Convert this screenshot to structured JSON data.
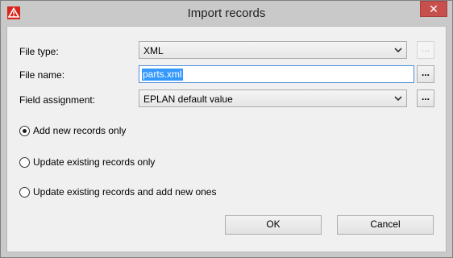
{
  "window": {
    "title": "Import records",
    "app_icon": "eplan-warning-triangle-icon",
    "close_icon": "close-icon",
    "close_glyph": "✕"
  },
  "form": {
    "file_type_label": "File type:",
    "file_type_value": "XML",
    "file_name_label": "File name:",
    "file_name_value": "parts.xml",
    "field_assignment_label": "Field assignment:",
    "field_assignment_value": "EPLAN default value",
    "browse_label": "..."
  },
  "options": {
    "add_new": "Add new records only",
    "update_existing": "Update existing records only",
    "update_and_add": "Update existing records and add new ones",
    "selected": "add_new"
  },
  "buttons": {
    "ok": "OK",
    "cancel": "Cancel"
  },
  "colors": {
    "close_button": "#c7504c",
    "selection": "#3399ff",
    "frame": "#c9c9c9"
  }
}
